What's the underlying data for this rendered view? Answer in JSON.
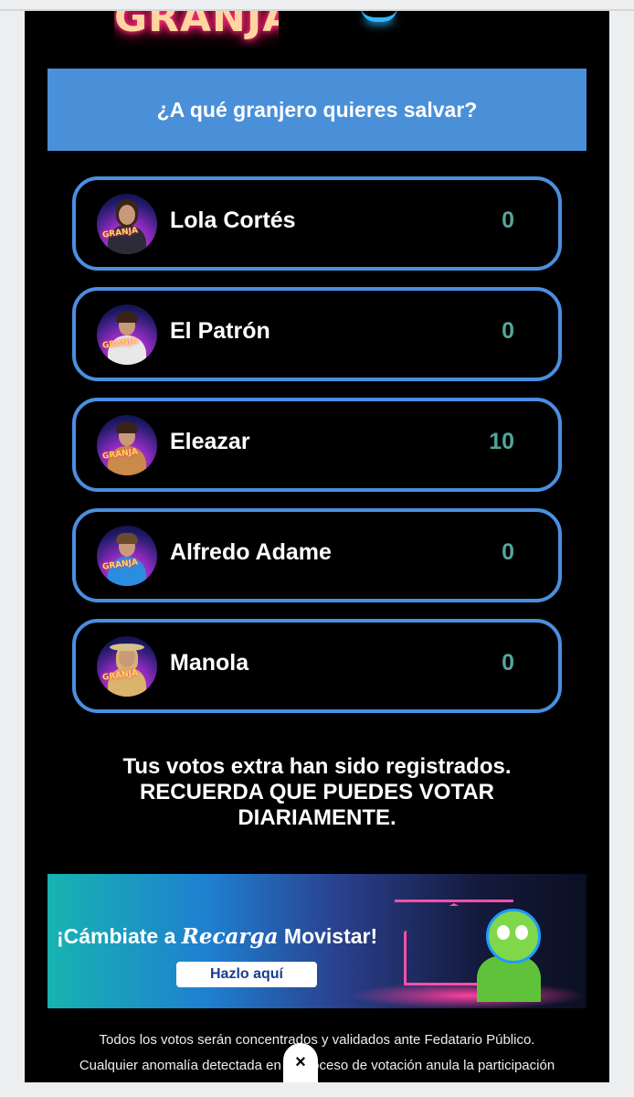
{
  "header": {
    "logo_text": "GRANJA"
  },
  "question": {
    "title": "¿A qué granjero quieres salvar?"
  },
  "candidates": [
    {
      "name": "Lola Cortés",
      "votes": "0",
      "badge": "GRANJA"
    },
    {
      "name": "El Patrón",
      "votes": "0",
      "badge": "GRANJA"
    },
    {
      "name": "Eleazar",
      "votes": "10",
      "badge": "GRANJA"
    },
    {
      "name": "Alfredo Adame",
      "votes": "0",
      "badge": "GRANJA"
    },
    {
      "name": "Manola",
      "votes": "0",
      "badge": "GRANJA"
    }
  ],
  "message": {
    "line1": "Tus votos extra han sido registrados.",
    "line2": "RECUERDA QUE PUEDES VOTAR",
    "line3": "DIARIAMENTE."
  },
  "banner": {
    "text_prefix": "¡Cámbiate a ",
    "brand_script": "Recarga",
    "text_suffix": " Movistar!",
    "button_label": "Hazlo aquí"
  },
  "disclaimer": {
    "line1": "Todos los votos serán concentrados y validados ante Fedatario Público.",
    "line2": "Cualquier anomalía detectada en el proceso de votación anula la participación"
  },
  "close_button": {
    "label": "×"
  },
  "colors": {
    "accent": "#4a90d9",
    "card_border": "#4a8fe0",
    "vote_count": "#55a49c",
    "background": "#000000"
  }
}
